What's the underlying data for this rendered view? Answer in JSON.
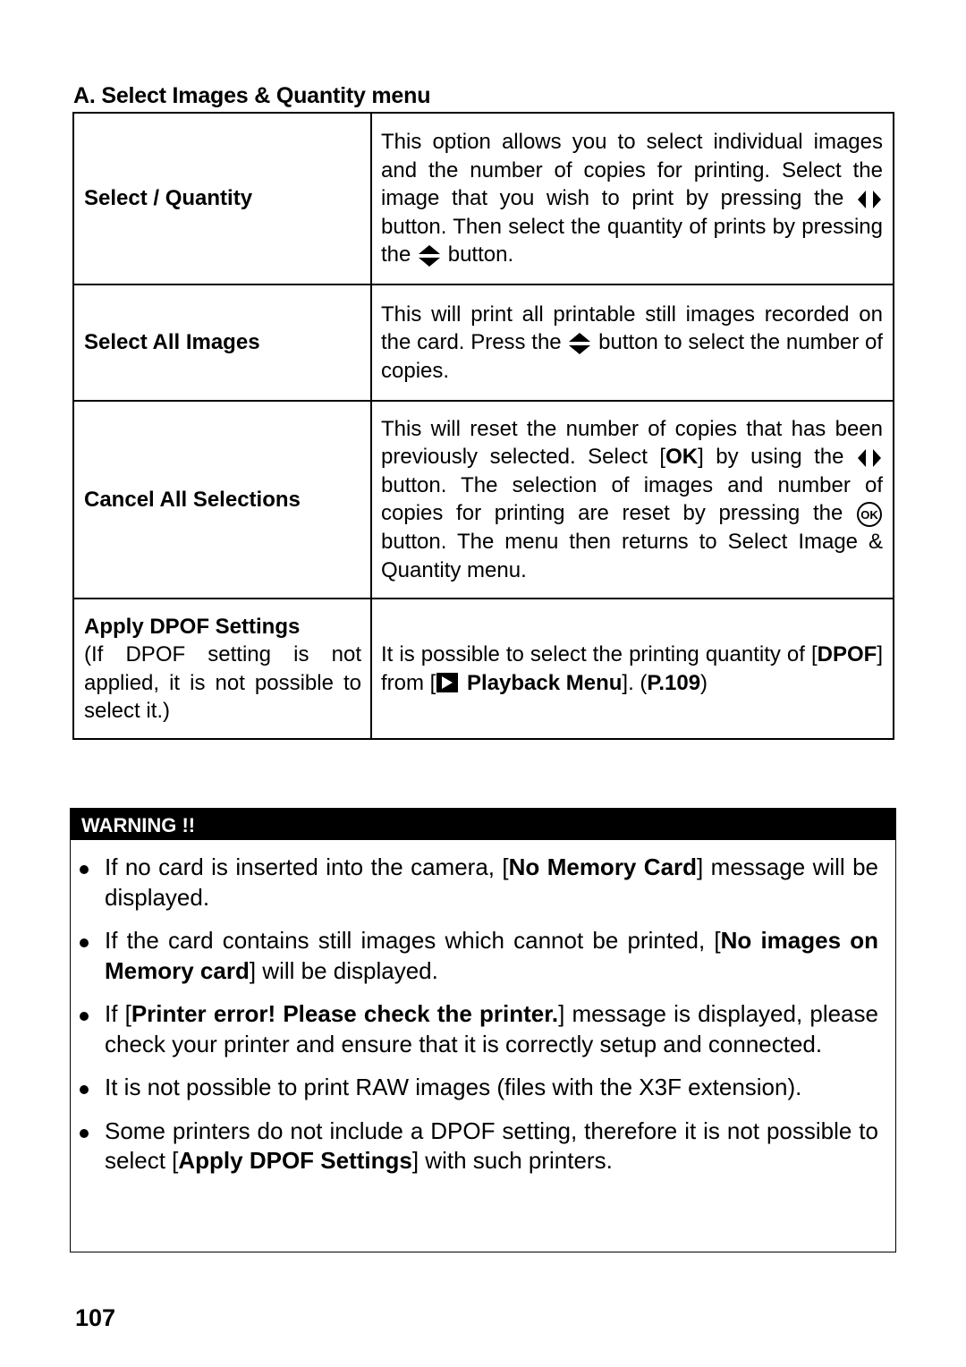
{
  "section_title": "A. Select Images & Quantity menu",
  "table": {
    "rows": [
      {
        "label": "Select / Quantity",
        "desc_parts": {
          "a": "This option allows you to select individual images and the number of copies for printing. Select the image that you wish to print by pressing the",
          "b": "button. Then select the quantity of prints by pressing the",
          "c": "button."
        }
      },
      {
        "label": "Select All Images",
        "desc_parts": {
          "a": "This will print all printable still images recorded on the card. Press the",
          "b": "button to select the number of copies."
        }
      },
      {
        "label": "Cancel All Selections",
        "desc_parts": {
          "a": "This will reset the number of copies that has been previously selected. Select [",
          "ok_bold": "OK",
          "b": "] by using the",
          "c": "button. The selection of images and number of copies for printing are reset by pressing the",
          "d": "button. The menu then returns to Select Image & Quantity menu."
        }
      },
      {
        "label": "Apply DPOF Settings",
        "note": "(If DPOF setting is not applied, it is not possible to select it.)",
        "desc_parts": {
          "a": "It is possible to select the printing quantity of [",
          "dpof": "DPOF",
          "b": "] from [",
          "menu": "Playback Menu",
          "c": "]. (",
          "page_ref": "P.109",
          "d": ")"
        }
      }
    ]
  },
  "warning": {
    "header": "WARNING !!",
    "items": [
      {
        "pre": "If no card is inserted into the camera, [",
        "bold": "No Memory Card",
        "post": "] message will be displayed."
      },
      {
        "pre": "If the card contains still images which cannot be printed, [",
        "bold": "No images on Memory card",
        "post": "] will be displayed."
      },
      {
        "pre": "If [",
        "bold": "Printer error! Please check the printer.",
        "post": "] message is displayed, please check your printer and ensure that it is correctly setup and connected."
      },
      {
        "pre": "It is not possible to print RAW images (files with the X3F extension).",
        "bold": "",
        "post": ""
      },
      {
        "pre": "Some printers do not include a DPOF setting, therefore it is not possible to select [",
        "bold": "Apply DPOF Settings",
        "post": "] with such printers."
      }
    ]
  },
  "icons": {
    "left_right": "left-right-arrow-button",
    "up_down": "up-down-arrow-button",
    "ok": "ok-button",
    "playback": "playback-triangle"
  },
  "page_number": "107"
}
